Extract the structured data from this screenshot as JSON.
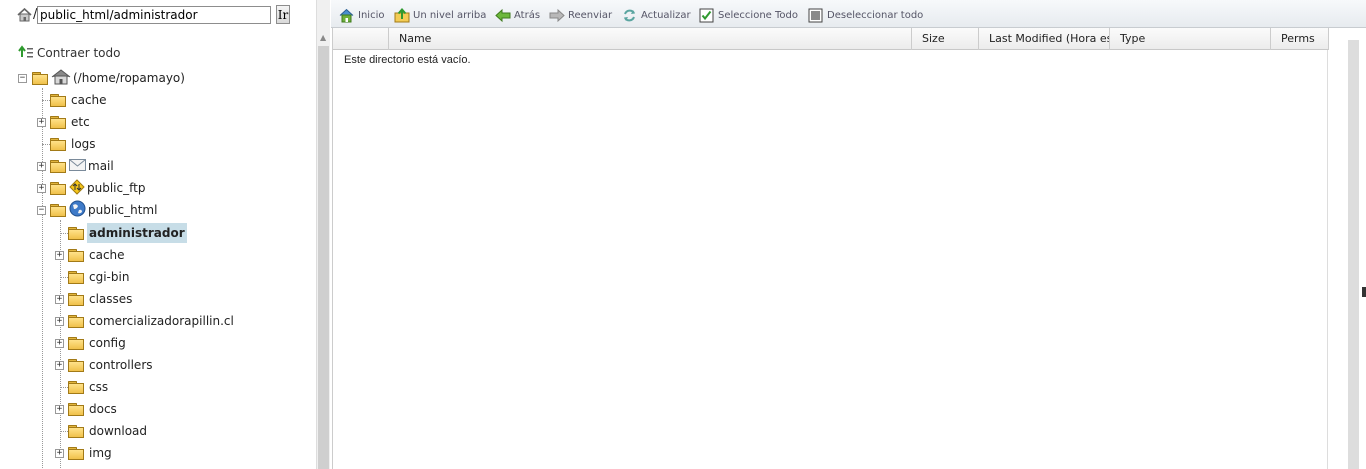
{
  "path_bar": {
    "slash": "/",
    "path_value": "public_html/administrador",
    "go_label": "Ir"
  },
  "collapse_all_label": "Contraer todo",
  "tree": {
    "root_label": "(/home/ropamayo)",
    "items": [
      {
        "label": "cache"
      },
      {
        "label": "etc"
      },
      {
        "label": "logs"
      },
      {
        "label": "mail"
      },
      {
        "label": "public_ftp"
      },
      {
        "label": "public_html"
      }
    ],
    "public_html_children": [
      {
        "label": "administrador"
      },
      {
        "label": "cache"
      },
      {
        "label": "cgi-bin"
      },
      {
        "label": "classes"
      },
      {
        "label": "comercializadorapillin.cl"
      },
      {
        "label": "config"
      },
      {
        "label": "controllers"
      },
      {
        "label": "css"
      },
      {
        "label": "docs"
      },
      {
        "label": "download"
      },
      {
        "label": "img"
      }
    ]
  },
  "toolbar": {
    "home_label": "Inicio",
    "up_label": "Un nivel arriba",
    "back_label": "Atrás",
    "forward_label": "Reenviar",
    "refresh_label": "Actualizar",
    "select_all_label": "Seleccione Todo",
    "deselect_all_label": "Deseleccionar todo"
  },
  "grid": {
    "columns": [
      "Name",
      "Size",
      "Last Modified (Hora está",
      "Type",
      "Perms"
    ],
    "empty_message": "Este directorio está vacío."
  },
  "colors": {
    "selection": "#c7dde7",
    "toolbar_text": "#556677",
    "folder": "#f0c14a"
  },
  "icons": [
    "home-icon",
    "collapse-icon",
    "folder-icon",
    "mail-icon",
    "ftp-icon",
    "globe-icon",
    "arrow-up-folder-icon",
    "back-arrow-icon",
    "forward-arrow-icon",
    "refresh-icon",
    "checkbox-checked-icon",
    "checkbox-unchecked-icon"
  ]
}
